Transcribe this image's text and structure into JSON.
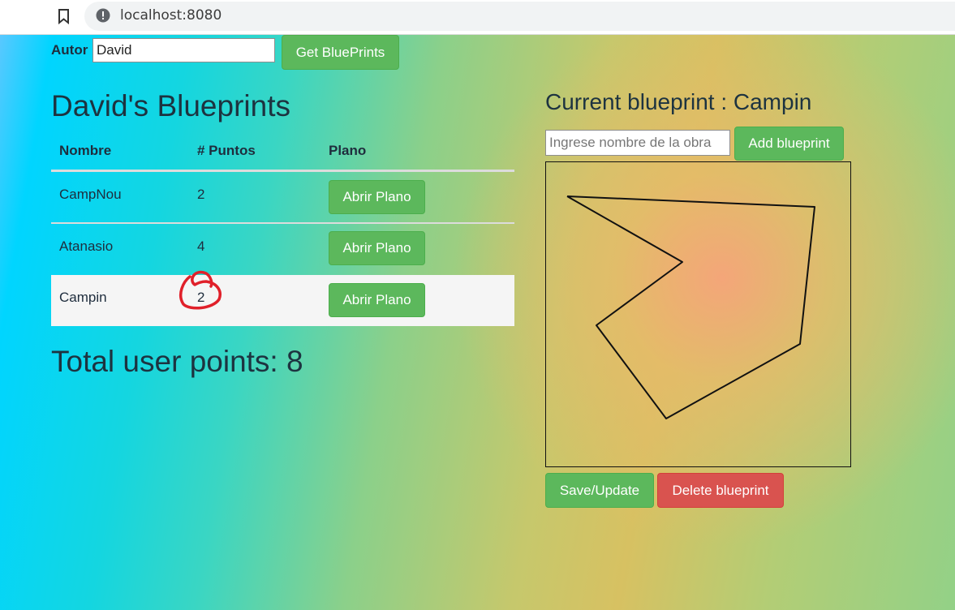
{
  "browser": {
    "url": "localhost:8080"
  },
  "author": {
    "label": "Autor",
    "value": "David",
    "get_button": "Get BluePrints"
  },
  "list": {
    "title": "David's Blueprints",
    "columns": [
      "Nombre",
      "# Puntos",
      "Plano"
    ],
    "rows": [
      {
        "name": "CampNou",
        "points": "2",
        "button": "Abrir Plano"
      },
      {
        "name": "Atanasio",
        "points": "4",
        "button": "Abrir Plano"
      },
      {
        "name": "Campin",
        "points": "2",
        "button": "Abrir Plano"
      }
    ],
    "selected_row_bg": "#f5f5f5",
    "total": "Total user points: 8"
  },
  "editor": {
    "title": "Current blueprint : Campin",
    "name_placeholder": "Ingrese nombre de la obra",
    "add_button": "Add blueprint",
    "save_button": "Save/Update",
    "delete_button": "Delete blueprint"
  },
  "colors": {
    "primary_green": "#5cb85c",
    "danger_red": "#d9534f",
    "annotation_red": "#e0202a"
  }
}
